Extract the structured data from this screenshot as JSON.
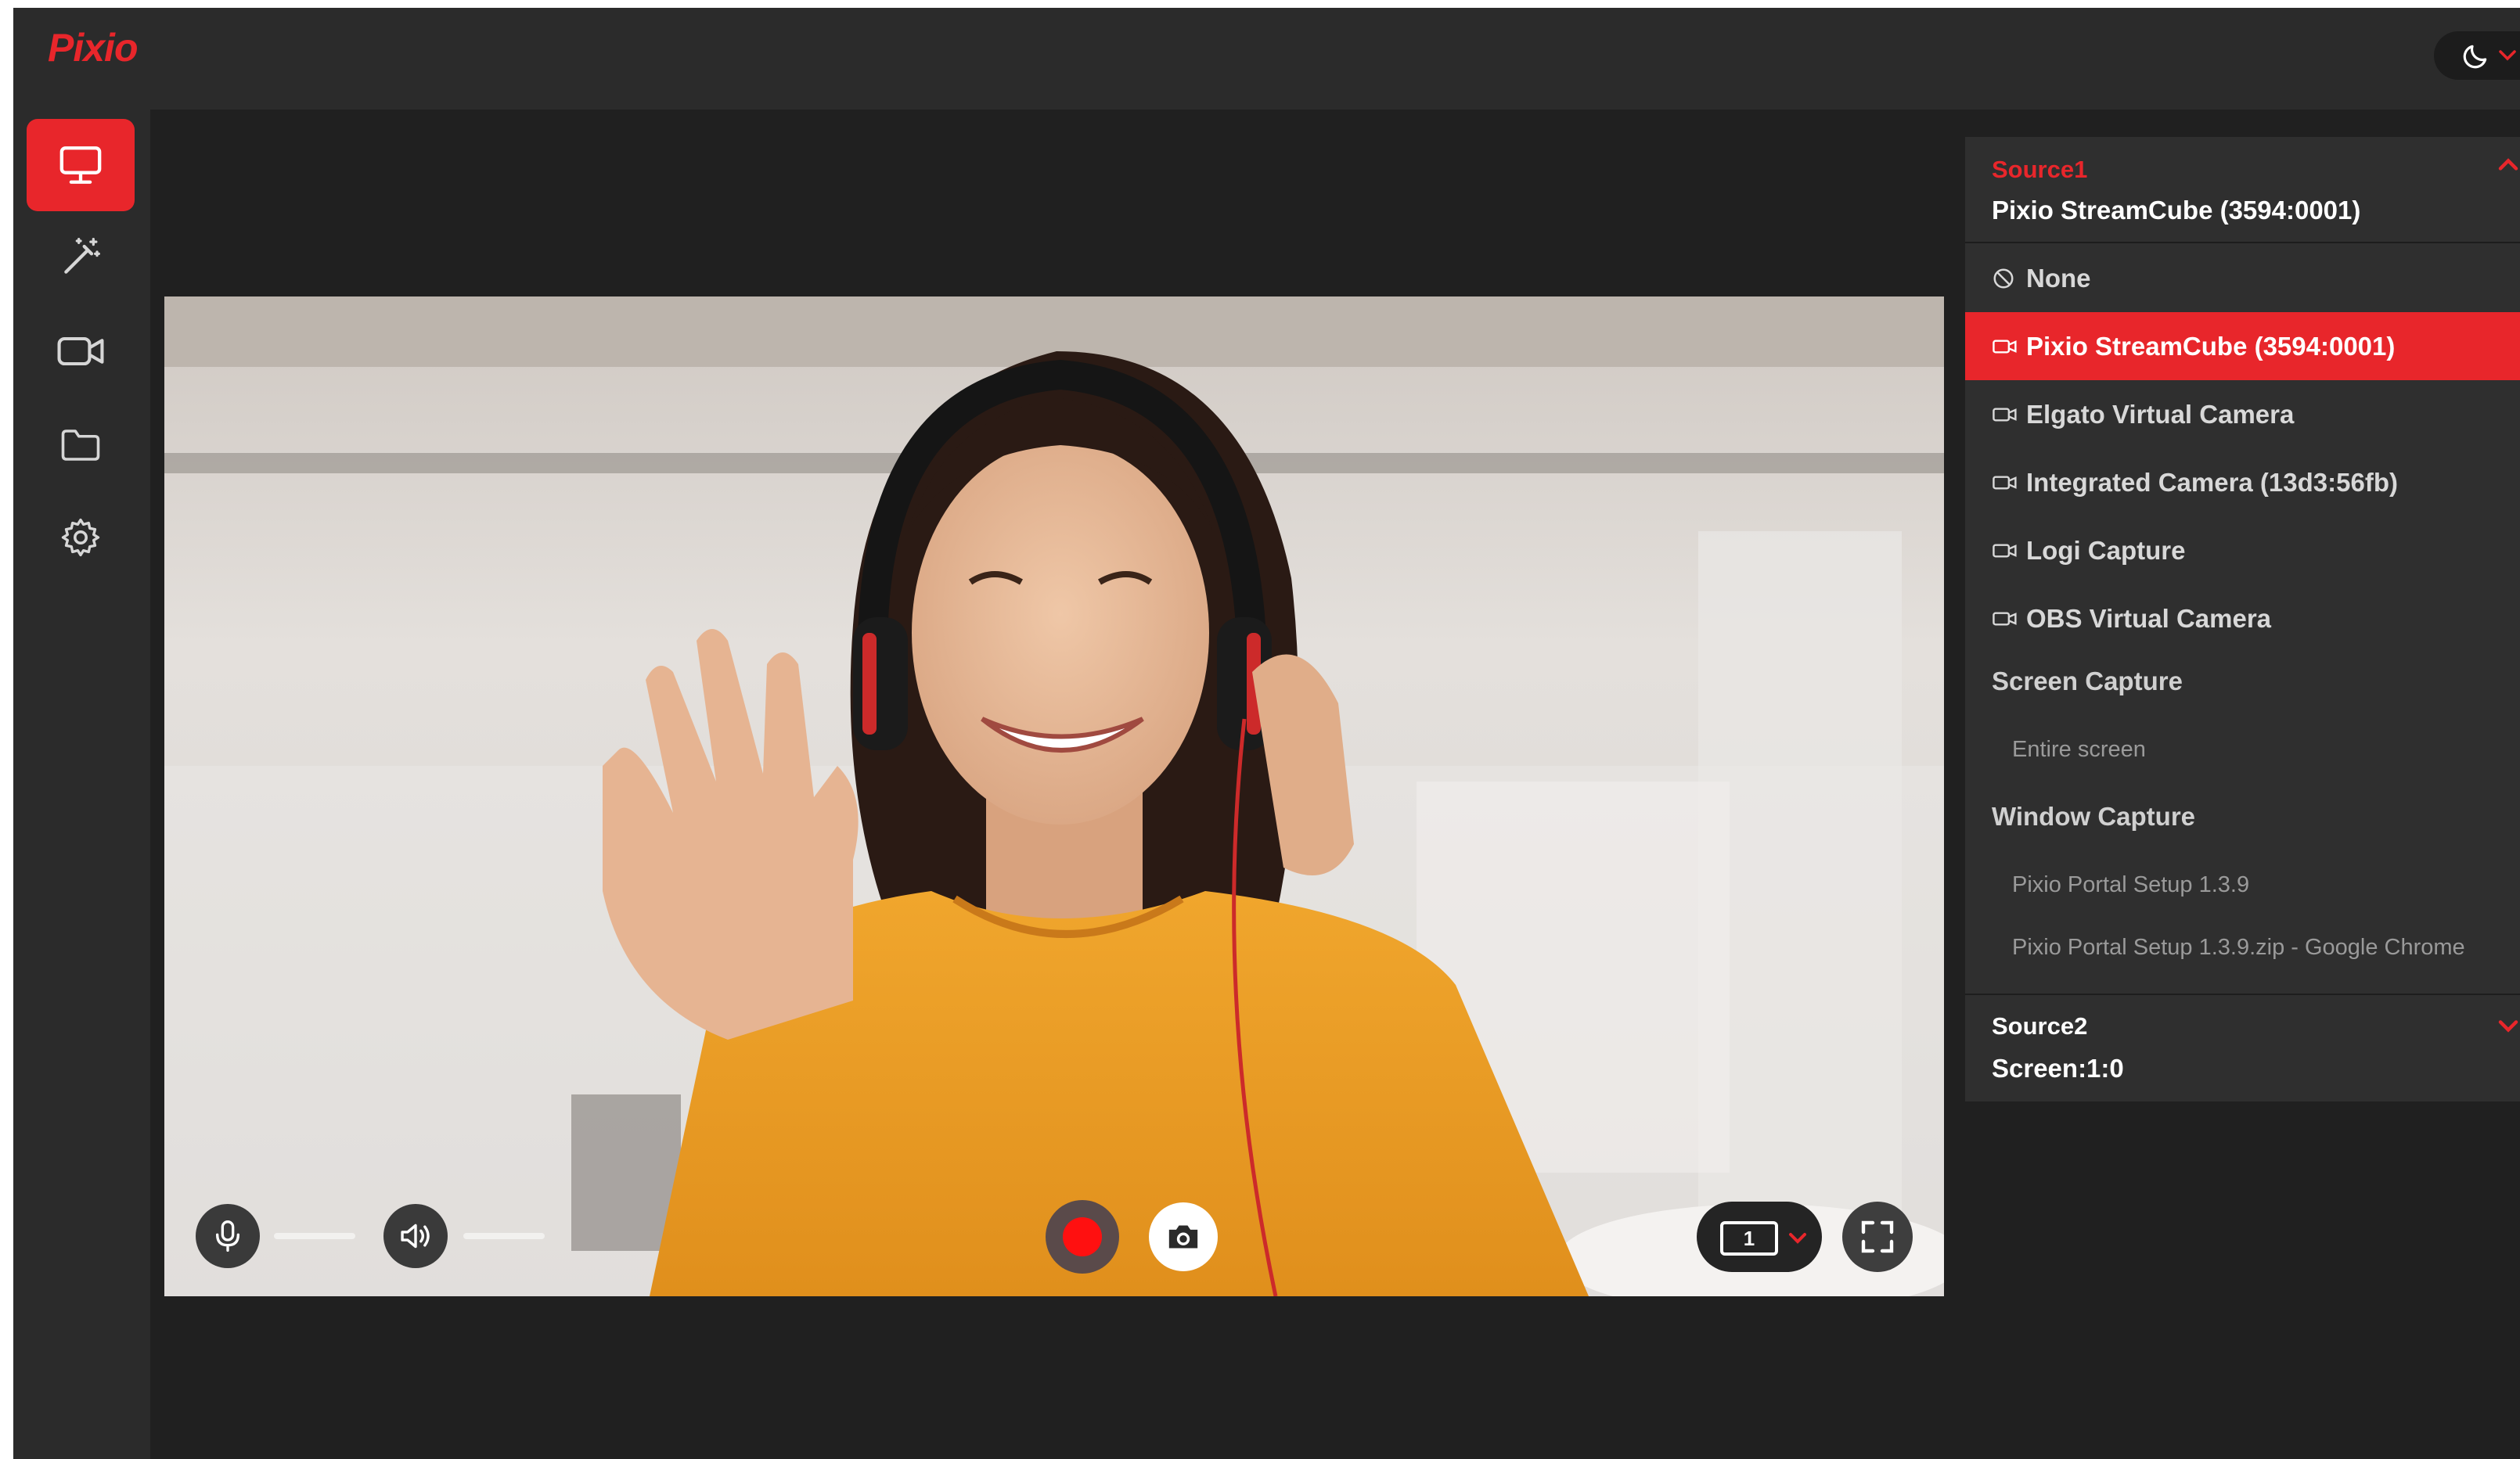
{
  "app": {
    "logo": "Pixio",
    "theme_icon": "moon-icon",
    "accent": "#e8262b"
  },
  "sidebar": {
    "items": [
      {
        "name": "display",
        "icon": "monitor-icon",
        "active": true
      },
      {
        "name": "effects",
        "icon": "magic-wand-icon",
        "active": false
      },
      {
        "name": "camera",
        "icon": "video-camera-icon",
        "active": false
      },
      {
        "name": "files",
        "icon": "folder-icon",
        "active": false
      },
      {
        "name": "settings",
        "icon": "gear-icon",
        "active": false
      }
    ]
  },
  "controls": {
    "mic_icon": "microphone-icon",
    "speaker_icon": "speaker-icon",
    "record_icon": "record-icon",
    "snapshot_icon": "camera-icon",
    "layout_count": "1",
    "fullscreen_icon": "fullscreen-icon"
  },
  "sources": {
    "source1": {
      "label": "Source1",
      "value": "Pixio StreamCube (3594:0001)",
      "expanded": true,
      "options": [
        {
          "label": "None",
          "icon": "ban-icon",
          "selected": false
        },
        {
          "label": "Pixio StreamCube (3594:0001)",
          "icon": "camera-icon",
          "selected": true
        },
        {
          "label": "Elgato Virtual Camera",
          "icon": "camera-icon",
          "selected": false
        },
        {
          "label": "Integrated Camera (13d3:56fb)",
          "icon": "camera-icon",
          "selected": false
        },
        {
          "label": "Logi Capture",
          "icon": "camera-icon",
          "selected": false
        },
        {
          "label": "OBS Virtual Camera",
          "icon": "camera-icon",
          "selected": false
        }
      ],
      "screen_capture": {
        "title": "Screen Capture",
        "items": [
          "Entire screen"
        ]
      },
      "window_capture": {
        "title": "Window Capture",
        "items": [
          "Pixio Portal Setup 1.3.9",
          "Pixio Portal Setup 1.3.9.zip - Google Chrome"
        ]
      }
    },
    "source2": {
      "label": "Source2",
      "value": "Screen:1:0",
      "expanded": false
    }
  }
}
